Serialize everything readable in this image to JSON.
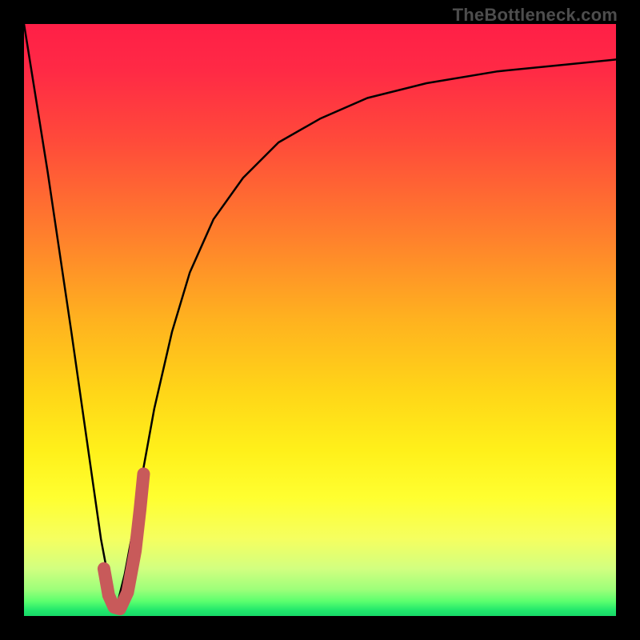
{
  "watermark": {
    "text": "TheBottleneck.com"
  },
  "gradient": {
    "stops": [
      {
        "offset": 0.0,
        "color": "#ff1f47"
      },
      {
        "offset": 0.08,
        "color": "#ff2a45"
      },
      {
        "offset": 0.2,
        "color": "#ff4b3a"
      },
      {
        "offset": 0.35,
        "color": "#ff7d2d"
      },
      {
        "offset": 0.5,
        "color": "#ffb21f"
      },
      {
        "offset": 0.62,
        "color": "#ffd518"
      },
      {
        "offset": 0.72,
        "color": "#fff01a"
      },
      {
        "offset": 0.8,
        "color": "#ffff30"
      },
      {
        "offset": 0.87,
        "color": "#f5ff60"
      },
      {
        "offset": 0.92,
        "color": "#d2ff80"
      },
      {
        "offset": 0.955,
        "color": "#9eff7a"
      },
      {
        "offset": 0.975,
        "color": "#5cff6e"
      },
      {
        "offset": 0.99,
        "color": "#22e86c"
      },
      {
        "offset": 1.0,
        "color": "#18d868"
      }
    ]
  },
  "chart_data": {
    "type": "line",
    "title": "",
    "xlabel": "",
    "ylabel": "",
    "xlim": [
      0,
      100
    ],
    "ylim": [
      0,
      100
    ],
    "series": [
      {
        "name": "bottleneck-curve-left",
        "x": [
          0,
          4,
          8,
          11,
          13,
          14.5,
          15.5
        ],
        "values": [
          100,
          75,
          48,
          27,
          13,
          5,
          1
        ]
      },
      {
        "name": "bottleneck-curve-right",
        "x": [
          15.5,
          17,
          18.5,
          20,
          22,
          25,
          28,
          32,
          37,
          43,
          50,
          58,
          68,
          80,
          92,
          100
        ],
        "values": [
          1,
          7,
          15,
          24,
          35,
          48,
          58,
          67,
          74,
          80,
          84,
          87.5,
          90,
          92,
          93.2,
          94
        ]
      }
    ],
    "accent": {
      "name": "optimal-J-mark",
      "color": "#c85a5a",
      "x": [
        13.5,
        14.3,
        15.2,
        16.2,
        17.5,
        18.8,
        19.6,
        20.2
      ],
      "values": [
        8,
        3.5,
        1.5,
        1.2,
        4,
        11,
        18,
        24
      ]
    }
  }
}
